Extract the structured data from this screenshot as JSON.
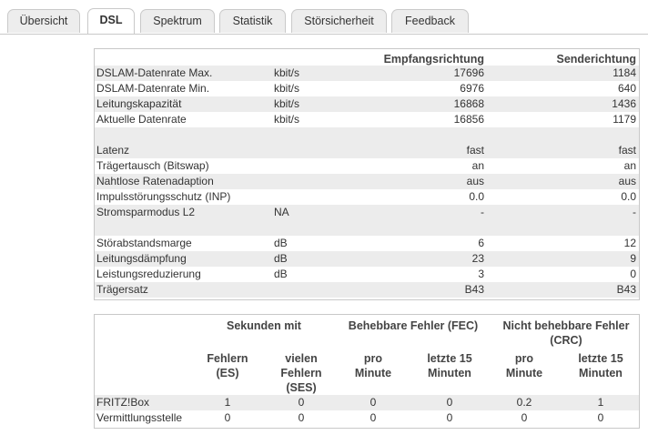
{
  "tabs": [
    {
      "label": "Übersicht"
    },
    {
      "label": "DSL"
    },
    {
      "label": "Spektrum"
    },
    {
      "label": "Statistik"
    },
    {
      "label": "Störsicherheit"
    },
    {
      "label": "Feedback"
    }
  ],
  "active_tab": "DSL",
  "table1": {
    "header": {
      "rx": "Empfangsrichtung",
      "tx": "Senderichtung"
    },
    "rows": [
      {
        "label": "DSLAM-Datenrate Max.",
        "unit": "kbit/s",
        "rx": "17696",
        "tx": "1184"
      },
      {
        "label": "DSLAM-Datenrate Min.",
        "unit": "kbit/s",
        "rx": "6976",
        "tx": "640"
      },
      {
        "label": "Leitungskapazität",
        "unit": "kbit/s",
        "rx": "16868",
        "tx": "1436"
      },
      {
        "label": "Aktuelle Datenrate",
        "unit": "kbit/s",
        "rx": "16856",
        "tx": "1179"
      },
      {
        "label": "Latenz",
        "unit": "",
        "rx": "fast",
        "tx": "fast"
      },
      {
        "label": "Trägertausch (Bitswap)",
        "unit": "",
        "rx": "an",
        "tx": "an"
      },
      {
        "label": "Nahtlose Ratenadaption",
        "unit": "",
        "rx": "aus",
        "tx": "aus"
      },
      {
        "label": "Impulsstörungsschutz (INP)",
        "unit": "",
        "rx": "0.0",
        "tx": "0.0"
      },
      {
        "label": "Stromsparmodus L2",
        "unit": "NA",
        "rx": "-",
        "tx": "-"
      },
      {
        "label": "Störabstandsmarge",
        "unit": "dB",
        "rx": "6",
        "tx": "12"
      },
      {
        "label": "Leitungsdämpfung",
        "unit": "dB",
        "rx": "23",
        "tx": "9"
      },
      {
        "label": "Leistungsreduzierung",
        "unit": "dB",
        "rx": "3",
        "tx": "0"
      },
      {
        "label": "Trägersatz",
        "unit": "",
        "rx": "B43",
        "tx": "B43"
      }
    ]
  },
  "table2": {
    "groups": {
      "seconds": "Sekunden mit",
      "fec": "Behebbare Fehler (FEC)",
      "crc": "Nicht behebbare Fehler (CRC)"
    },
    "columns": {
      "es": "Fehlern (ES)",
      "ses": "vielen Fehlern (SES)",
      "fec_min": "pro Minute",
      "fec_15": "letzte 15 Minuten",
      "crc_min": "pro Minute",
      "crc_15": "letzte 15 Minuten"
    },
    "rows": [
      {
        "label": "FRITZ!Box",
        "es": "1",
        "ses": "0",
        "fec_min": "0",
        "fec_15": "0",
        "crc_min": "0.2",
        "crc_15": "1"
      },
      {
        "label": "Vermittlungsstelle",
        "es": "0",
        "ses": "0",
        "fec_min": "0",
        "fec_15": "0",
        "crc_min": "0",
        "crc_15": "0"
      }
    ]
  }
}
